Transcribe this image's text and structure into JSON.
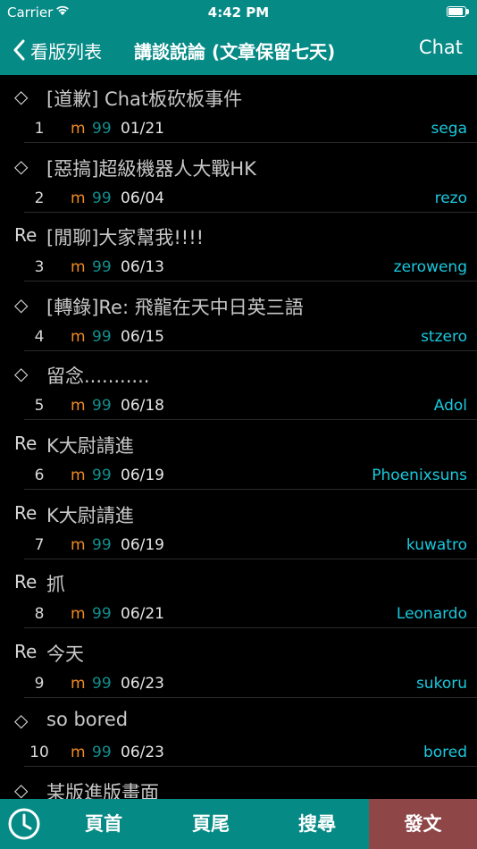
{
  "status_bar": {
    "carrier": "Carrier",
    "time": "4:42 PM"
  },
  "nav": {
    "back_label": "看版列表",
    "title": "講談說論 (文章保留七天)",
    "right_label": "Chat"
  },
  "posts": [
    {
      "mark": "◇",
      "title": "[道歉] Chat板砍板事件",
      "num": "1",
      "m": "m",
      "score": "99",
      "date": "01/21",
      "author": "sega"
    },
    {
      "mark": "◇",
      "title": "[惡搞]超級機器人大戰HK",
      "num": "2",
      "m": "m",
      "score": "99",
      "date": "06/04",
      "author": "rezo"
    },
    {
      "mark": "Re",
      "title": "[閒聊]大家幫我!!!!",
      "num": "3",
      "m": "m",
      "score": "99",
      "date": "06/13",
      "author": "zeroweng"
    },
    {
      "mark": "◇",
      "title": "[轉錄]Re: 飛龍在天中日英三語",
      "num": "4",
      "m": "m",
      "score": "99",
      "date": "06/15",
      "author": "stzero"
    },
    {
      "mark": "◇",
      "title": "留念...........",
      "num": "5",
      "m": "m",
      "score": "99",
      "date": "06/18",
      "author": "Adol"
    },
    {
      "mark": "Re",
      "title": "K大尉請進",
      "num": "6",
      "m": "m",
      "score": "99",
      "date": "06/19",
      "author": "Phoenixsuns"
    },
    {
      "mark": "Re",
      "title": "K大尉請進",
      "num": "7",
      "m": "m",
      "score": "99",
      "date": "06/19",
      "author": "kuwatro"
    },
    {
      "mark": "Re",
      "title": "抓",
      "num": "8",
      "m": "m",
      "score": "99",
      "date": "06/21",
      "author": "Leonardo"
    },
    {
      "mark": "Re",
      "title": "今天",
      "num": "9",
      "m": "m",
      "score": "99",
      "date": "06/23",
      "author": "sukoru"
    },
    {
      "mark": "◇",
      "title": "so bored",
      "num": "10",
      "m": "m",
      "score": "99",
      "date": "06/23",
      "author": "bored"
    },
    {
      "mark": "◇",
      "title": "某版進版畫面",
      "num": "",
      "m": "",
      "score": "",
      "date": "",
      "author": ""
    }
  ],
  "toolbar": {
    "icon": "clock-icon",
    "first_page": "頁首",
    "last_page": "頁尾",
    "search": "搜尋",
    "post": "發文"
  },
  "colors": {
    "bar": "#068a86",
    "post_button": "#8e4646",
    "author": "#19c9de",
    "m_flag": "#f08a22",
    "score": "#138e8d"
  }
}
